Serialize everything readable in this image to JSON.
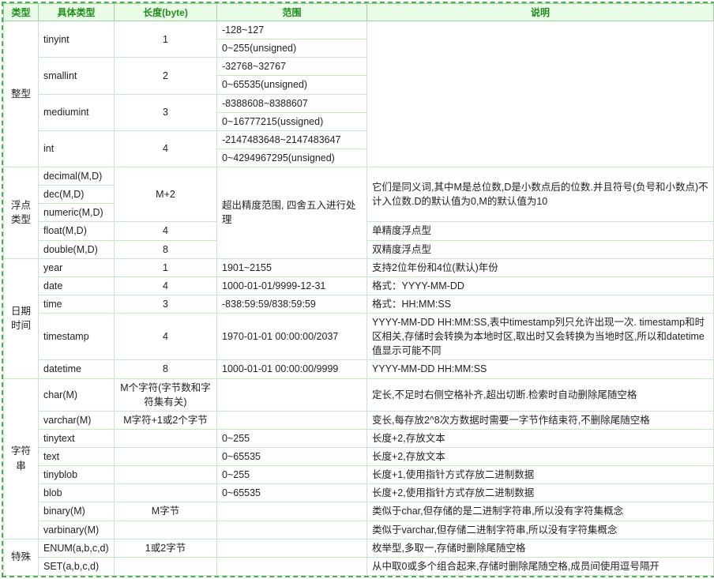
{
  "headers": {
    "type": "类型",
    "subtype": "具体类型",
    "length": "长度(byte)",
    "range": "范围",
    "desc": "说明"
  },
  "cat": {
    "int": "整型",
    "float": "浮点类型",
    "date": "日期时间",
    "string": "字符串",
    "special": "特殊"
  },
  "int": {
    "tinyint": {
      "name": "tinyint",
      "len": "1",
      "r1": "-128~127",
      "r2": "0~255(unsigned)"
    },
    "smallint": {
      "name": "smallint",
      "len": "2",
      "r1": "-32768~32767",
      "r2": "0~65535(unsigned)"
    },
    "mediumint": {
      "name": "mediumint",
      "len": "3",
      "r1": "-8388608~8388607",
      "r2": "0~16777215(ussigned)"
    },
    "int_": {
      "name": "int",
      "len": "4",
      "r1": "-2147483648~2147483647",
      "r2": "0~4294967295(unsigned)"
    }
  },
  "float": {
    "decimal": "decimal(M,D)",
    "dec": "dec(M,D)",
    "numeric": "numeric(M,D)",
    "float_": "float(M,D)",
    "double_": "double(M,D)",
    "len_mp2": "M+2",
    "len4": "4",
    "len8": "8",
    "range_note": "超出精度范围, 四舍五入进行处理",
    "desc1": "它们是同义词,其中M是总位数,D是小数点后的位数.并且符号(负号和小数点)不计入位数.D的默认值为0,M的默认值为10",
    "desc_single": "单精度浮点型",
    "desc_double": "双精度浮点型"
  },
  "date": {
    "year": {
      "name": "year",
      "len": "1",
      "range": "1901~2155",
      "desc": "支持2位年份和4位(默认)年份"
    },
    "date_": {
      "name": "date",
      "len": "4",
      "range": "1000-01-01/9999-12-31",
      "desc": "格式：YYYY-MM-DD"
    },
    "time_": {
      "name": "time",
      "len": "3",
      "range": "-838:59:59/838:59:59",
      "desc": "格式：HH:MM:SS"
    },
    "ts": {
      "name": "timestamp",
      "len": "4",
      "range": "1970-01-01 00:00:00/2037",
      "desc": "YYYY-MM-DD HH:MM:SS,表中timestamp列只允许出现一次. timestamp和时区相关,存储时会转换为本地时区,取出时又会转换为当地时区,所以和datetime值显示可能不同"
    },
    "dt": {
      "name": "datetime",
      "len": "8",
      "range": "1000-01-01 00:00:00/9999",
      "desc": "YYYY-MM-DD HH:MM:SS"
    }
  },
  "string": {
    "char_": {
      "name": "char(M)",
      "len": "M个字符(字节数和字符集有关)",
      "desc": "定长,不足时右侧空格补齐,超出切断.检索时自动删除尾随空格"
    },
    "varchar_": {
      "name": "varchar(M)",
      "len": "M字符+1或2个字节",
      "desc": "变长,每存放2^8次方数据时需要一字节作结束符,不删除尾随空格"
    },
    "tinytext_": {
      "name": "tinytext",
      "range": "0~255",
      "desc": "长度+2,存放文本"
    },
    "text_": {
      "name": "text",
      "range": "0~65535",
      "desc": "长度+2,存放文本"
    },
    "tinyblob_": {
      "name": "tinyblob",
      "range": "0~255",
      "desc": "长度+1,使用指针方式存放二进制数据"
    },
    "blob_": {
      "name": "blob",
      "range": "0~65535",
      "desc": "长度+2,使用指针方式存放二进制数据"
    },
    "binary_": {
      "name": "binary(M)",
      "len": "M字节",
      "desc": "类似于char,但存储的是二进制字符串,所以没有字符集概念"
    },
    "varbinary_": {
      "name": "varbinary(M)",
      "desc": "类似于varchar,但存储二进制字符串,所以没有字符集概念"
    }
  },
  "special": {
    "enum_": {
      "name": "ENUM(a,b,c,d)",
      "len": "1或2字节",
      "desc": "枚举型,多取一,存储时删除尾随空格"
    },
    "set_": {
      "name": "SET(a,b,c,d)",
      "desc": "从中取0或多个组合起来,存储时删除尾随空格,成员间使用逗号隔开"
    }
  }
}
